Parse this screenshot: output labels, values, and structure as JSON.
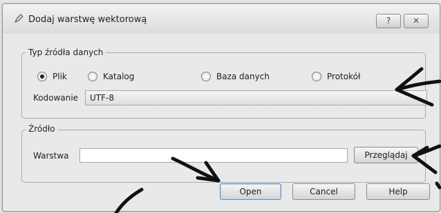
{
  "window": {
    "title": "Dodaj warstwę wektorową",
    "help_button": "?",
    "close_button": "✕"
  },
  "source_type": {
    "legend": "Typ źródła danych",
    "options": [
      "Plik",
      "Katalog",
      "Baza danych",
      "Protokół"
    ],
    "selected": "Plik",
    "encoding_label": "Kodowanie",
    "encoding_value": "UTF-8"
  },
  "source": {
    "legend": "Źródło",
    "layer_label": "Warstwa",
    "layer_value": "",
    "browse_button": "Przeglądaj"
  },
  "buttons": {
    "open": "Open",
    "cancel": "Cancel",
    "help": "Help"
  }
}
